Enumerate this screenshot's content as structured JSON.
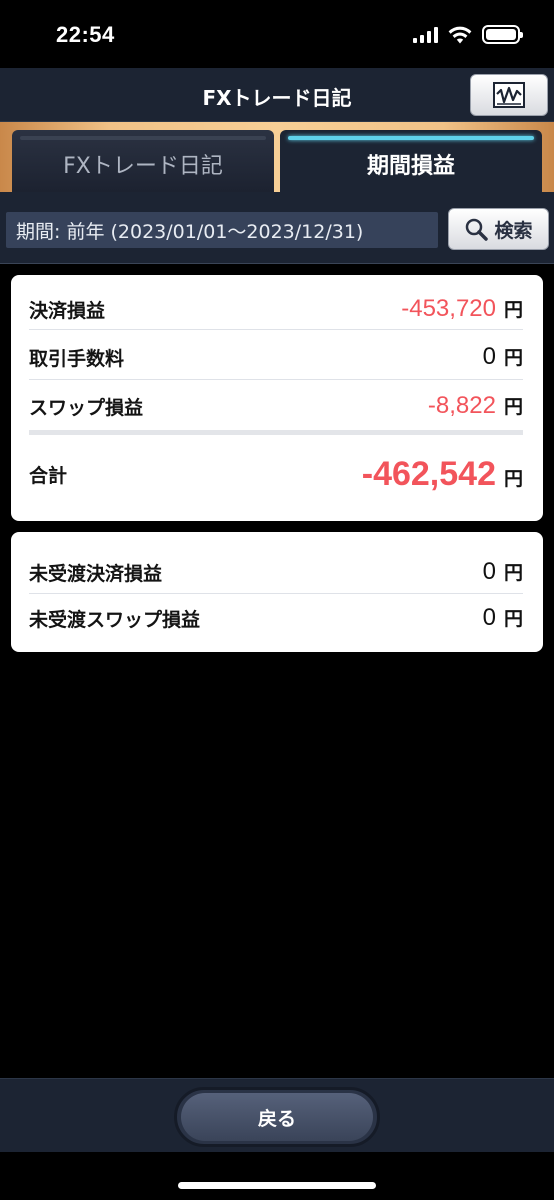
{
  "status_bar": {
    "time": "22:54"
  },
  "nav": {
    "title": "FXトレード日記"
  },
  "tabs": [
    {
      "label": "FXトレード日記",
      "selected": false
    },
    {
      "label": "期間損益",
      "selected": true
    }
  ],
  "period": {
    "text": "期間: 前年 (2023/01/01～2023/12/31)",
    "search_label": "検索"
  },
  "summary": {
    "rows": [
      {
        "label": "決済損益",
        "value": "-453,720",
        "unit": "円"
      },
      {
        "label": "取引手数料",
        "value": "0",
        "unit": "円"
      },
      {
        "label": "スワップ損益",
        "value": "-8,822",
        "unit": "円"
      }
    ],
    "total": {
      "label": "合計",
      "value": "-462,542",
      "unit": "円"
    }
  },
  "unsettled": {
    "rows": [
      {
        "label": "未受渡決済損益",
        "value": "0",
        "unit": "円"
      },
      {
        "label": "未受渡スワップ損益",
        "value": "0",
        "unit": "円"
      }
    ]
  },
  "footer": {
    "back_label": "戻る"
  },
  "colors": {
    "negative": "#f2545b",
    "accent_tab": "#5fd1ea",
    "header_bg": "#1c2433"
  }
}
